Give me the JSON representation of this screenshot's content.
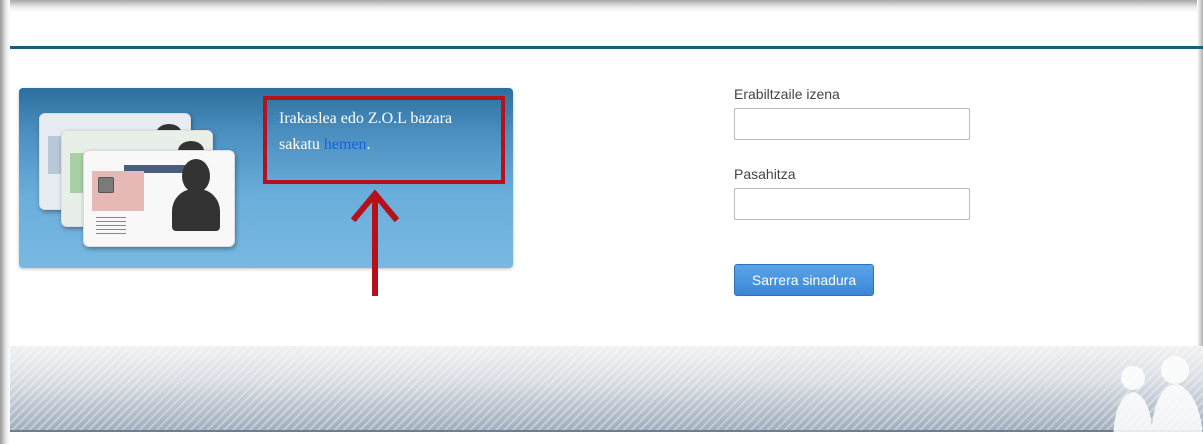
{
  "banner": {
    "line1": "Irakaslea edo Z.O.L bazara",
    "line2_prefix": "sakatu ",
    "link_text": "hemen",
    "line2_suffix": "."
  },
  "login": {
    "username_label": "Erabiltzaile izena",
    "username_value": "",
    "password_label": "Pasahitza",
    "password_value": "",
    "submit_label": "Sarrera sinadura"
  },
  "icons": [
    "id-cards-illustration-icon",
    "up-arrow-icon",
    "people-silhouette-icon"
  ],
  "colors": {
    "accent": "#3b87d6",
    "annotation": "#b5111b",
    "banner": "#4a8fc0",
    "link": "#1565d8"
  }
}
